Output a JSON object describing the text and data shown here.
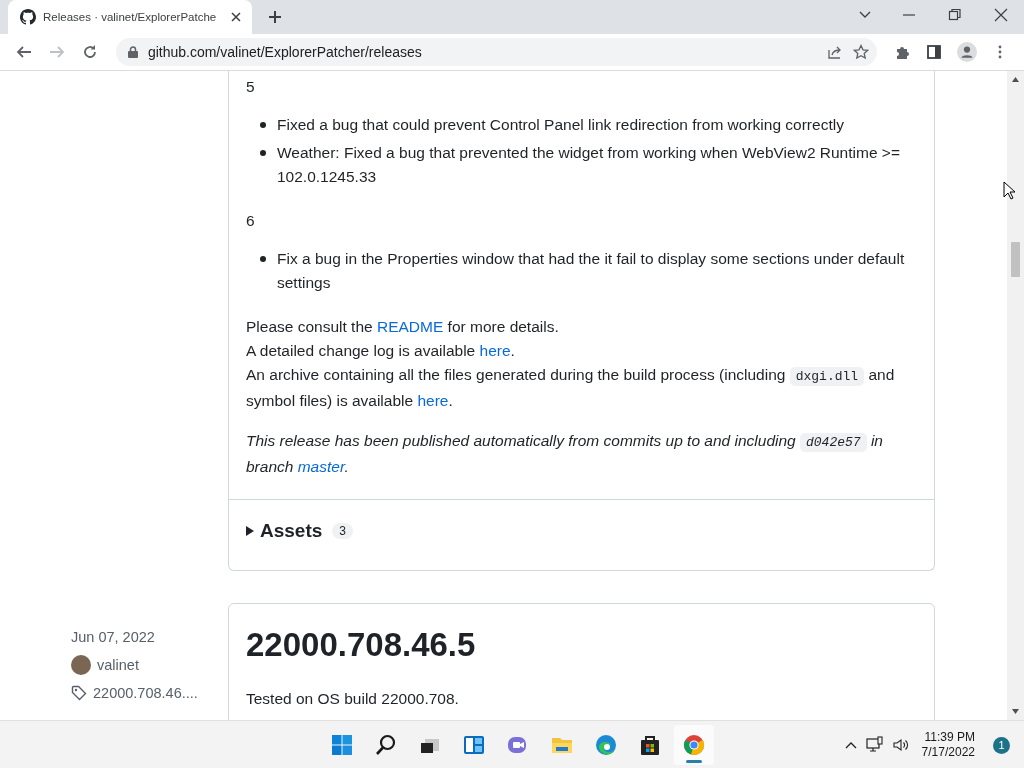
{
  "browser": {
    "tab": {
      "title": "Releases · valinet/ExplorerPatche"
    },
    "address": "github.com/valinet/ExplorerPatcher/releases"
  },
  "release": {
    "sections": [
      {
        "number": "5",
        "items": [
          "Fixed a bug that could prevent Control Panel link redirection from working correctly",
          "Weather: Fixed a bug that prevented the widget from working when WebView2 Runtime >= 102.0.1245.33"
        ]
      },
      {
        "number": "6",
        "items": [
          "Fix a bug in the Properties window that had the it fail to display some sections under default settings"
        ]
      }
    ],
    "lines": [
      [
        {
          "kind": "text",
          "text": "Please consult the "
        },
        {
          "kind": "link",
          "text": "README"
        },
        {
          "kind": "text",
          "text": " for more details."
        }
      ],
      [
        {
          "kind": "text",
          "text": "A detailed change log is available "
        },
        {
          "kind": "link",
          "text": "here"
        },
        {
          "kind": "text",
          "text": "."
        }
      ],
      [
        {
          "kind": "text",
          "text": "An archive containing all the files generated during the build process (including "
        },
        {
          "kind": "code",
          "text": "dxgi.dll"
        },
        {
          "kind": "text",
          "text": " and symbol files) is available "
        },
        {
          "kind": "link",
          "text": "here"
        },
        {
          "kind": "text",
          "text": "."
        }
      ]
    ],
    "note": [
      {
        "kind": "text",
        "text": "This release has been published automatically from commits up to and including "
      },
      {
        "kind": "code",
        "text": "d042e57"
      },
      {
        "kind": "text",
        "text": " in branch "
      },
      {
        "kind": "link",
        "text": "master"
      },
      {
        "kind": "text",
        "text": "."
      }
    ],
    "assets": {
      "label": "Assets",
      "count": "3",
      "expanded": false
    }
  },
  "next_release": {
    "date": "Jun 07, 2022",
    "author": "valinet",
    "tag": "22000.708.46....",
    "title": "22000.708.46.5",
    "description": "Tested on OS build 22000.708."
  },
  "taskbar": {
    "apps": [
      {
        "kind": "start",
        "active": false
      },
      {
        "kind": "search",
        "active": false
      },
      {
        "kind": "taskview",
        "active": false
      },
      {
        "kind": "widgets",
        "active": false
      },
      {
        "kind": "chat",
        "active": false
      },
      {
        "kind": "explorer",
        "active": false
      },
      {
        "kind": "edge",
        "active": false
      },
      {
        "kind": "store",
        "active": false
      },
      {
        "kind": "chrome",
        "active": true
      }
    ],
    "time": "11:39 PM",
    "date": "7/17/2022",
    "notifications": "1"
  }
}
